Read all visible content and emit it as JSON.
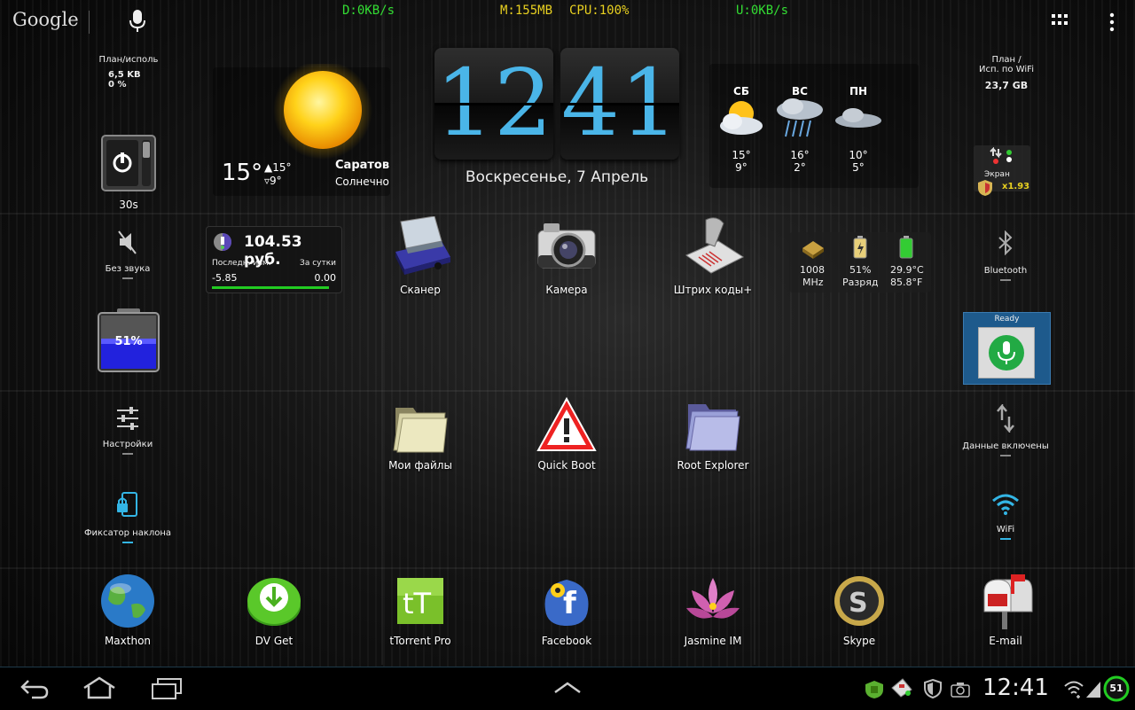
{
  "top": {
    "google_label": "Google",
    "download_speed": "D:0KB/s",
    "memory": "M:155MB",
    "cpu": "CPU:100%",
    "upload_speed": "U:0KB/s"
  },
  "left_widgets": {
    "plan_title": "План/исполь",
    "plan_value": "6,5 KB",
    "plan_percent": "0 %",
    "timeout_label": "30s",
    "mute_label": "Без звука",
    "battery_percent": "51%",
    "settings_label": "Настройки",
    "rotation_label": "Фиксатор наклона"
  },
  "weather": {
    "temp_now": "15°",
    "temp_high": "▲15°",
    "temp_low": "▿9°",
    "city": "Саратов",
    "condition": "Солнечно",
    "forecast": [
      {
        "day": "СБ",
        "high": "15°",
        "low": "9°"
      },
      {
        "day": "ВС",
        "high": "16°",
        "low": "2°"
      },
      {
        "day": "ПН",
        "high": "10°",
        "low": "5°"
      }
    ]
  },
  "clock": {
    "hours": "12",
    "minutes": "41",
    "date": "Воскресенье, 7 Апрель"
  },
  "currency": {
    "value": "104.53 руб.",
    "last_change_label": "Последн. изм.",
    "day_label": "За сутки",
    "last_change": "-5.85",
    "day_change": "0.00"
  },
  "apps_row1": [
    {
      "name": "Сканер"
    },
    {
      "name": "Камера"
    },
    {
      "name": "Штрих коды+"
    }
  ],
  "apps_row2": [
    {
      "name": "Мои файлы"
    },
    {
      "name": "Quick Boot"
    },
    {
      "name": "Root Explorer"
    }
  ],
  "sysinfo": {
    "cpu_freq": "1008",
    "cpu_unit": "MHz",
    "battery": "51%",
    "battery_state": "Разряд",
    "temp_c": "29.9°C",
    "temp_f": "85.8°F"
  },
  "right_widgets": {
    "wifi_plan_title": "План /",
    "wifi_plan_sub": "Исп. по WiFi",
    "wifi_plan_value": "23,7 GB",
    "screen_label": "Экран",
    "screen_mult": "x1.93",
    "bluetooth_label": "Bluetooth",
    "voice_status": "Ready",
    "data_label": "Данные включены",
    "wifi_label": "WiFi"
  },
  "dock": [
    {
      "name": "Maxthon"
    },
    {
      "name": "DV Get"
    },
    {
      "name": "tTorrent Pro"
    },
    {
      "name": "Facebook"
    },
    {
      "name": "Jasmine IM"
    },
    {
      "name": "Skype"
    },
    {
      "name": "E-mail"
    }
  ],
  "statusbar": {
    "time": "12:41",
    "battery_badge": "51"
  },
  "colors": {
    "accent": "#33b5e5",
    "download": "#33dd33",
    "memory": "#e8d020"
  }
}
